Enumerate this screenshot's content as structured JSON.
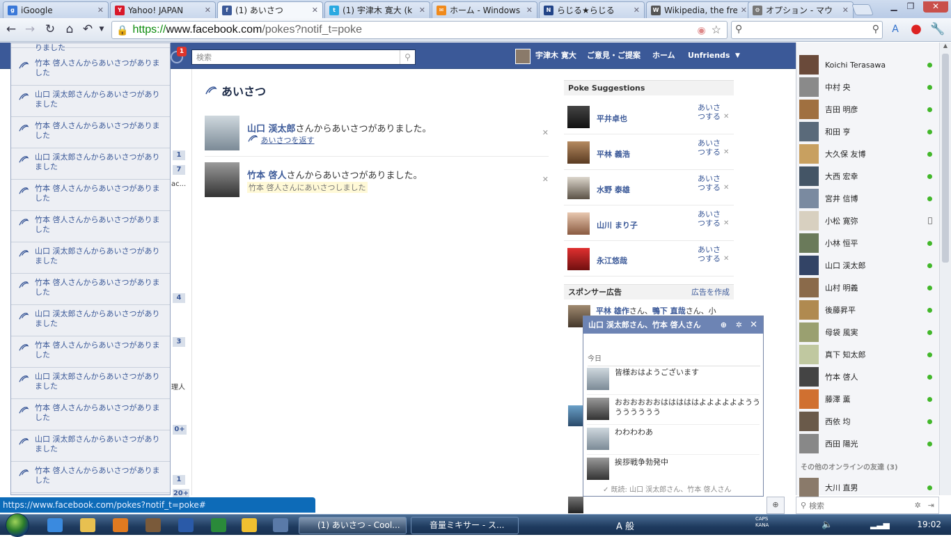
{
  "browser": {
    "tabs": [
      {
        "title": "iGoogle",
        "icon": "google-icon",
        "color": "#3a78d8"
      },
      {
        "title": "Yahoo! JAPAN",
        "icon": "yahoo-icon",
        "color": "#d8182a"
      },
      {
        "title": "(1) あいさつ",
        "icon": "facebook-icon",
        "color": "#3b5998",
        "active": true
      },
      {
        "title": "(1) 宇津木 寛大 (k",
        "icon": "twitter-icon",
        "color": "#29a9e1"
      },
      {
        "title": "ホーム - Windows",
        "icon": "mail-icon",
        "color": "#f08a1c"
      },
      {
        "title": "らじる★らじる",
        "icon": "nhk-icon",
        "color": "#224488"
      },
      {
        "title": "Wikipedia, the fre",
        "icon": "wikipedia-icon",
        "color": "#555555"
      },
      {
        "title": "オプション - マウ",
        "icon": "wrench-icon",
        "color": "#777777"
      }
    ],
    "url_scheme": "https://",
    "url_host": "www.facebook.com",
    "url_path": "/pokes?notif_t=poke"
  },
  "fb": {
    "search_placeholder": "検索",
    "notif_badge": "1",
    "user_name": "宇津木 寛大",
    "nav": [
      "ご意見・ご提案",
      "ホーム",
      "Unfriends"
    ],
    "page_title": "あいさつ",
    "pokes": [
      {
        "name": "山口 渓太郎",
        "text": "さんからあいさつがありました。",
        "action": "あいさつを返す",
        "style": "link"
      },
      {
        "name": "竹本 啓人",
        "text": "さんからあいさつがありました。",
        "action": "竹本 啓人さんにあいさつしました",
        "style": "done"
      }
    ],
    "left_counts": [
      "1",
      "7",
      "4",
      "3",
      "0+",
      "1",
      "20+"
    ],
    "left_fragments": [
      "ac...",
      "理人"
    ]
  },
  "notifications": [
    "りました",
    "竹本 啓人さんからあいさつがありました",
    "山口 渓太郎さんからあいさつがありました",
    "竹本 啓人さんからあいさつがありました",
    "山口 渓太郎さんからあいさつがありました",
    "竹本 啓人さんからあいさつがありました",
    "竹本 啓人さんからあいさつがありました",
    "山口 渓太郎さんからあいさつがありました",
    "竹本 啓人さんからあいさつがありました",
    "山口 渓太郎さんからあいさつがありました",
    "竹本 啓人さんからあいさつがありました",
    "山口 渓太郎さんからあいさつがありました",
    "竹本 啓人さんからあいさつがありました",
    "山口 渓太郎さんからあいさつがありました",
    "竹本 啓人さんからあいさつがありました"
  ],
  "suggestions": {
    "header": "Poke Suggestions",
    "poke_label": "あいさつする",
    "items": [
      "平井卓也",
      "平林 義浩",
      "水野 泰雄",
      "山川 まり子",
      "永江悠哉"
    ]
  },
  "sponsor": {
    "header": "スポンサー広告",
    "create": "広告を作成",
    "snippet_names": [
      "平林 雄作",
      "鴨下 直哉"
    ],
    "snippet_text": [
      "さん、",
      "さん、小"
    ]
  },
  "chat": {
    "title": "山口 渓太郎さん、竹本 啓人さん",
    "date": "今日",
    "messages": [
      "皆様おはようございます",
      "おおおおおおはははははよよよよよようううううううう",
      "わわわわあ",
      "挨拶戦争勃発中"
    ],
    "seen": "既読: 山口 渓太郎さん、竹本 啓人さん"
  },
  "friends": {
    "online": [
      "Koichi Terasawa",
      "中村 央",
      "吉田 明彦",
      "和田 亨",
      "大久保 友博",
      "大西 宏幸",
      "宮井 信博",
      "小松 寛弥",
      "小林 恒平",
      "山口 渓太郎",
      "山村 明義",
      "後藤昇平",
      "母袋 風実",
      "真下 知太郎",
      "竹本 啓人",
      "藤澤 薫",
      "西依 均",
      "西田 陽光"
    ],
    "other_header": "その他のオンラインの友達 (3)",
    "other": [
      "大川 直男"
    ],
    "search_placeholder": "検索"
  },
  "status_url": "https://www.facebook.com/pokes?notif_t=poke#",
  "taskbar": {
    "tasks": [
      "(1) あいさつ - Cool...",
      "音量ミキサー - ス..."
    ],
    "ime": "A 般",
    "caps": "CAPS",
    "kana": "KANA",
    "time": "19:02"
  }
}
